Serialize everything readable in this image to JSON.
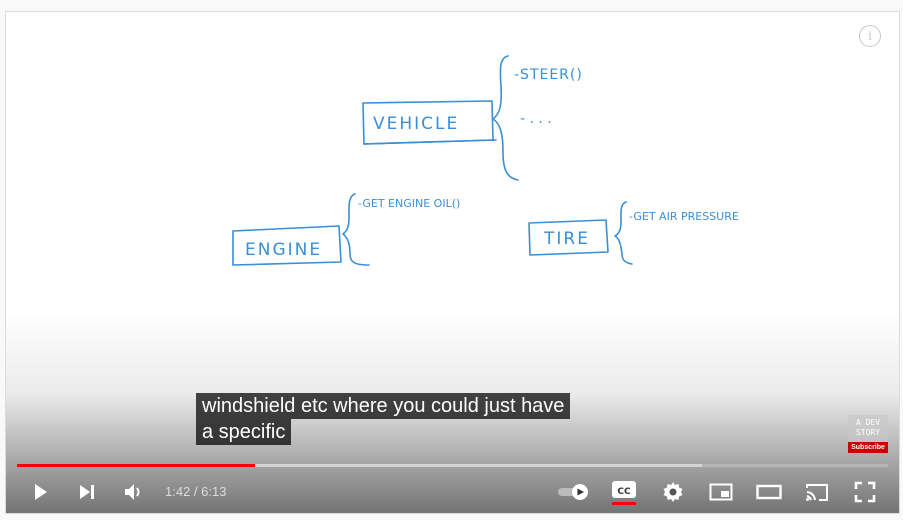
{
  "video": {
    "whiteboard": {
      "vehicle_label": "VEHICLE",
      "vehicle_methods": [
        "-STEER()",
        "- . . ."
      ],
      "engine_label": "ENGINE",
      "engine_method": "-GET ENGINE OIL()",
      "tire_label": "TIRE",
      "tire_method": "-GET AIR PRESSURE"
    },
    "captions": [
      "windshield etc where you could just have",
      "a specific"
    ],
    "watermark": {
      "channel": "A DEV\nSTORY",
      "subscribe": "Subscribe"
    }
  },
  "controls": {
    "current_time": "1:42",
    "separator": " / ",
    "duration": "6:13",
    "progress_played": 0.273,
    "progress_loaded": 0.787,
    "autoplay_on": true
  },
  "colors": {
    "ink": "#3a8fd6",
    "progress": "#ff0000",
    "cc_underline": "#ff0000"
  }
}
